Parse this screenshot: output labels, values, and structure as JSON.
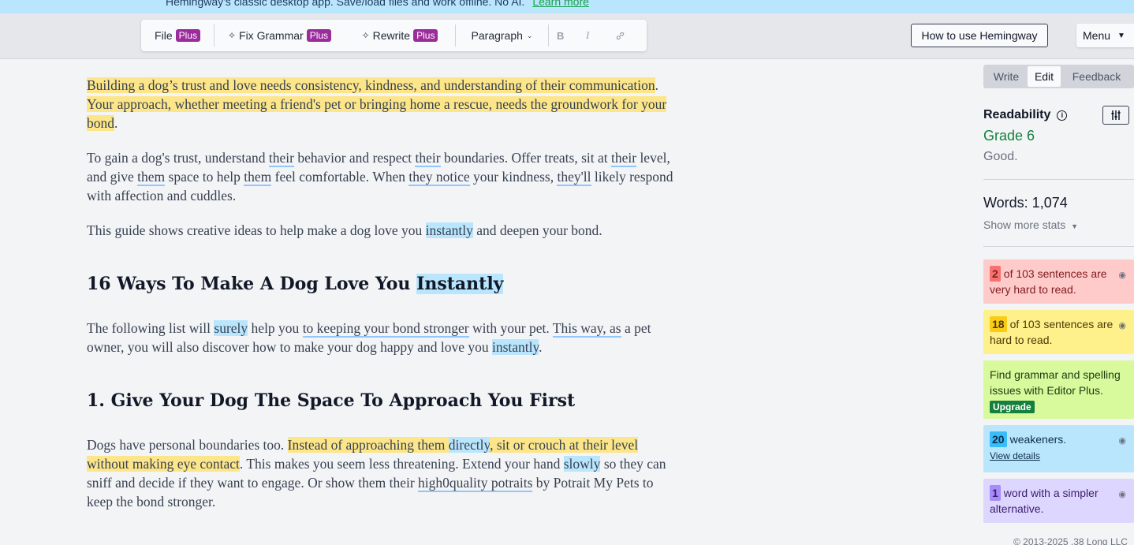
{
  "banner": {
    "text": "Hemingway's classic desktop app. Save/load files and work offline. No AI.",
    "link": "Learn more"
  },
  "toolbar": {
    "file": "File",
    "fix_grammar": "Fix Grammar",
    "rewrite": "Rewrite",
    "plus_badge": "Plus",
    "paragraph": "Paragraph",
    "bold": "B",
    "italic": "I",
    "link_icon": "link-icon"
  },
  "header": {
    "how_to": "How to use Hemingway",
    "menu": "Menu"
  },
  "editor": {
    "p1": {
      "a": "Building a dog’s trust and love needs consistency, kindness, and understanding of their communication",
      "b": ".",
      "c": " ",
      "d": "Your approach, whether meeting a friend's pet or bringing home a rescue, needs the groundwork for your bond",
      "e": "."
    },
    "p2": {
      "t1": "To gain a dog's trust, understand ",
      "u1": "their",
      "t2": " behavior and respect ",
      "u2": "their",
      "t3": " boundaries. Offer treats, sit at ",
      "u3": "their",
      "t4": " level, and give ",
      "u4": "them",
      "t5": " space to help ",
      "u5": "them",
      "t6": " feel comfortable. When ",
      "u6": "they notice",
      "t7": " your kindness, ",
      "u7": "they'll",
      "t8": " likely respond with affection and cuddles."
    },
    "p3": {
      "t1": "This guide shows creative ideas to help make a dog love you ",
      "b1": "instantly",
      "t2": " and deepen your bond."
    },
    "h1": {
      "t1": "16 Ways To Make A Dog Love You ",
      "b1": "Instantly"
    },
    "p4": {
      "t1": "The following list will ",
      "b1": "surely",
      "t2": " help you ",
      "u1": "to keeping your bond stronger",
      "t3": " with your pet. ",
      "u2": "This way, as",
      "t4": " a pet owner, you will also discover how to make your dog happy and love you ",
      "b2": "instantly",
      "t5": "."
    },
    "h2": "1. Give Your Dog The Space To Approach You First",
    "p5": {
      "t1": "Dogs have personal boundaries too. ",
      "y1": "Instead of approaching them ",
      "b1": "directly",
      "y2": ", sit or crouch at their level without making eye contact",
      "t2": ". This makes you seem less threatening. Extend your hand ",
      "b2": "slowly",
      "t3": " so they can sniff and decide if they want to engage. Or show them their ",
      "u1": "high0quality potraits",
      "t4": " by Potrait My Pets to keep the bond stronger."
    }
  },
  "sidebar": {
    "tabs": [
      "Write",
      "Edit",
      "Feedback"
    ],
    "readability_label": "Readability",
    "grade": "Grade 6",
    "grade_note": "Good.",
    "words": "Words: 1,074",
    "show_more": "Show more stats",
    "cards": {
      "very_hard": {
        "count": "2",
        "text": "of 103 sentences are very hard to read."
      },
      "hard": {
        "count": "18",
        "text": "of 103 sentences are hard to read."
      },
      "grammar": {
        "text": "Find grammar and spelling issues with Editor Plus.",
        "button": "Upgrade"
      },
      "weakeners": {
        "count": "20",
        "text": "weakeners.",
        "link": "View details"
      },
      "simpler": {
        "count": "1",
        "text": "word with a simpler alternative."
      }
    }
  },
  "footer": {
    "copyright": "© 2013-2025 .38 Long LLC"
  },
  "colors": {
    "plus_badge": "#9b2c9b",
    "grade": "#15803d",
    "highlight_yellow": "#fde68a",
    "highlight_blue": "#bae6fd"
  }
}
